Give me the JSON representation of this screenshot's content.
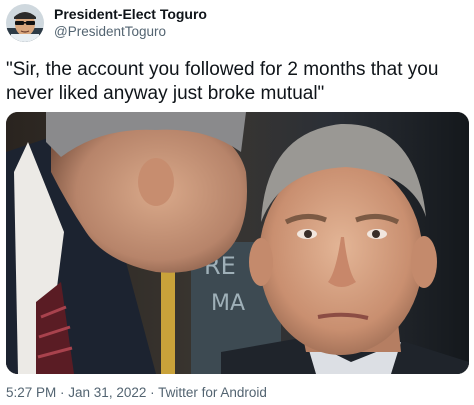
{
  "author": {
    "display_name": "President-Elect Toguro",
    "handle": "@PresidentToguro",
    "avatar_icon": "avatar-cartoon-sunglasses"
  },
  "tweet": {
    "text": "\"Sir, the account you followed for 2 months that you never liked anyway just broke mutual\""
  },
  "media": {
    "description_icon": "photo-whispering-meme",
    "board_letters": [
      "RE",
      "MA"
    ]
  },
  "meta": {
    "time": "5:27 PM",
    "separator": " · ",
    "date": "Jan 31, 2022",
    "source": "Twitter for Android"
  },
  "colors": {
    "text_primary": "#0f1419",
    "text_secondary": "#536471",
    "background": "#ffffff"
  }
}
